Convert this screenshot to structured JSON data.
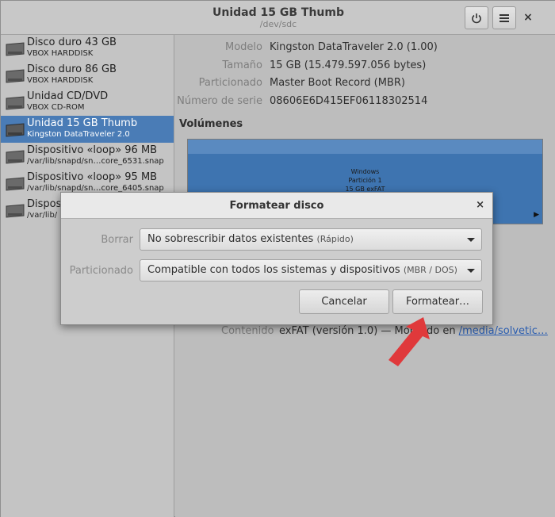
{
  "header": {
    "title": "Unidad 15 GB Thumb",
    "subtitle": "/dev/sdc",
    "power_icon": "power-icon",
    "menu_icon": "hamburger-menu-icon",
    "close_glyph": "×"
  },
  "sidebar": {
    "items": [
      {
        "name": "Disco duro 43 GB",
        "sub": "VBOX HARDDISK"
      },
      {
        "name": "Disco duro 86 GB",
        "sub": "VBOX HARDDISK"
      },
      {
        "name": "Unidad CD/DVD",
        "sub": "VBOX CD-ROM"
      },
      {
        "name": "Unidad 15 GB Thumb",
        "sub": "Kingston DataTraveler 2.0"
      },
      {
        "name": "Dispositivo «loop» 96 MB",
        "sub": "/var/lib/snapd/sn…core_6531.snap"
      },
      {
        "name": "Dispositivo «loop» 95 MB",
        "sub": "/var/lib/snapd/sn…core_6405.snap"
      },
      {
        "name": "Dispos",
        "sub": "/var/lib/"
      }
    ]
  },
  "details": {
    "model_label": "Modelo",
    "model_value": "Kingston DataTraveler 2.0 (1.00)",
    "size_label": "Tamaño",
    "size_value": "15 GB (15.479.597.056 bytes)",
    "partitioning_label": "Particionado",
    "partitioning_value": "Master Boot Record (MBR)",
    "serial_label": "Número de serie",
    "serial_value": "08606E6D415EF06118302514"
  },
  "volumes": {
    "heading": "Volúmenes",
    "line1": "Windows",
    "line2": "Partición 1",
    "line3": "15 GB exFAT",
    "content_label": "Contenido",
    "content_value": "exFAT (versión 1.0) — Montado en",
    "content_link": "/media/solvetic…"
  },
  "dialog": {
    "title": "Formatear disco",
    "close_glyph": "×",
    "erase_label": "Borrar",
    "erase_value": "No sobrescribir datos existentes",
    "erase_hint": "(Rápido)",
    "partition_label": "Particionado",
    "partition_value": "Compatible con todos los sistemas y dispositivos",
    "partition_hint": "(MBR / DOS)",
    "cancel_label": "Cancelar",
    "format_label": "Formatear…"
  },
  "colors": {
    "selection": "#4a7cb6",
    "volume_fill": "#3e74b0",
    "annotation_arrow": "#e0393b"
  }
}
